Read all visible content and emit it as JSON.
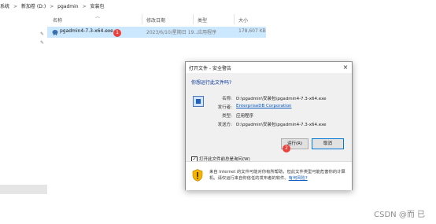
{
  "explorer": {
    "breadcrumb": [
      "系统",
      "新加卷 (D:)",
      "pgadmin",
      "安装包"
    ],
    "breadcrumb_sep": ">",
    "columns": {
      "name": "名称",
      "date": "修改日期",
      "type": "类型",
      "size": "大小"
    },
    "file": {
      "name": "pgadmin4-7.3-x64.exe",
      "date": "2023/6/10/星期日 19...",
      "type": "应用程序",
      "size": "178,607 KB",
      "badge": "1"
    },
    "pin_icon": "pin-icon"
  },
  "dialog": {
    "title": "打开文件 - 安全警告",
    "close_label": "×",
    "question": "你想运行此文件吗?",
    "fields": {
      "name_label": "名称:",
      "name_value": "D:\\pgadmin\\安装包\\pgadmin4-7.3-x64.exe",
      "publisher_label": "发行者:",
      "publisher_value": "EnterpriseDB Corporation",
      "type_label": "类型:",
      "type_value": "应用程序",
      "from_label": "发送方:",
      "from_value": "D:\\pgadmin\\安装包\\pgadmin4-7.3-x64.exe"
    },
    "buttons": {
      "run": "运行(R)",
      "cancel": "取消",
      "badge": "2"
    },
    "checkbox": {
      "label": "打开此文件前总是询问(W)",
      "checked": "✓"
    },
    "warning": {
      "text": "来自 Internet 的文件可能对你有所帮助，但此文件类型可能危害你的计算机。请仅运行来自你信任的发布者的软件。",
      "link": "有何风险?"
    }
  },
  "watermark": "CSDN @而 已",
  "colors": {
    "selection": "#cce8ff",
    "badge": "#e8423d",
    "link": "#0a58c2",
    "dialog_body": "#f0f0f0"
  }
}
